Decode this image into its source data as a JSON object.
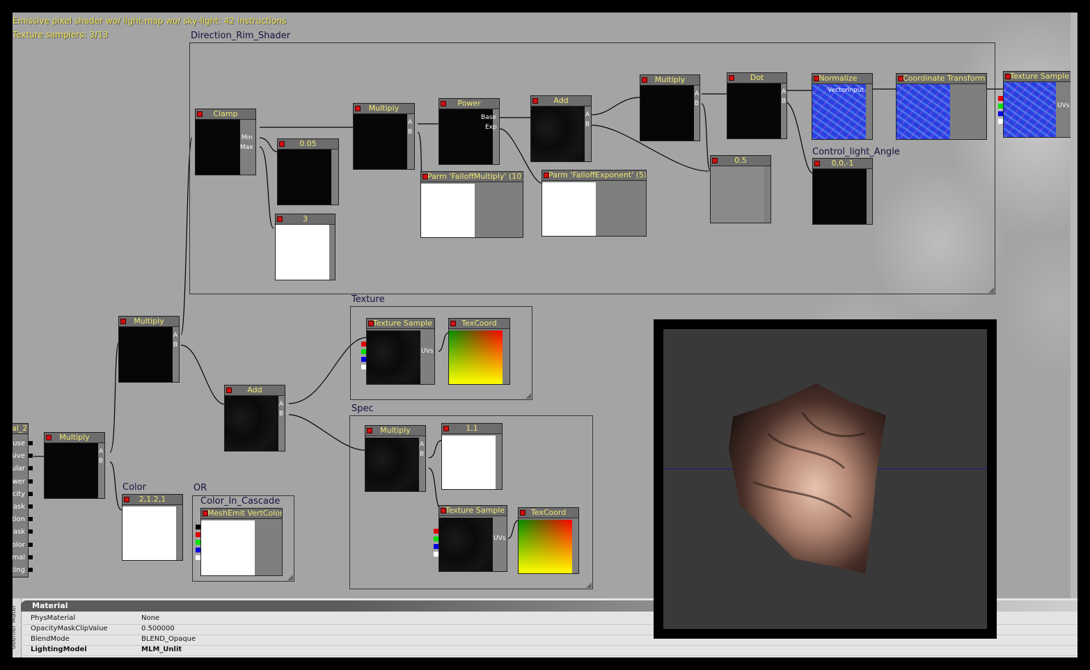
{
  "stats": {
    "line1": "Emissive pixel shader wo/ light-map wo/ sky-light: 42 instructions",
    "line2": "Texture samplers: 3/13"
  },
  "groups": {
    "direction_rim": "Direction_Rim_Shader",
    "texture": "Texture",
    "spec": "Spec",
    "color": "Color",
    "or": "OR",
    "color_in_cascade": "Color_In_Cascade",
    "control_light_angle": "Control_light_Angle"
  },
  "nodes": {
    "clamp": "Clamp",
    "const_005": "0.05",
    "const_3": "3",
    "multiply_top": "Multiply",
    "power": "Power",
    "parm_falloff_multiply": "Parm 'FalloffMultiply' (10)",
    "add_top": "Add",
    "parm_falloff_exponent": "Parm 'FalloffExponent' (5)",
    "multiply_top2": "Multiply",
    "dot": "Dot",
    "const_05": "0.5",
    "normalize": "Normalize",
    "coordinate_transform": "Coordinate Transform",
    "texture_sample_top": "Texture Sample",
    "const_vec": "0,0,-1",
    "multiply_mid": "Multiply",
    "add_mid": "Add",
    "texture_sample_tex": "Texture Sample",
    "texcoord_tex": "TexCoord",
    "multiply_spec": "Multiply",
    "const_11": "1.1",
    "texture_sample_spec": "Texture Sample",
    "texcoord_spec": "TexCoord",
    "multiply_left": "Multiply",
    "color_const": "2,1.2,1",
    "mesh_emit_vertcolor": "MeshEmit VertColor",
    "material_fragment": "al_2"
  },
  "pin_labels": {
    "min": "Min",
    "max": "Max",
    "a": "A",
    "b": "B",
    "base": "Base",
    "exp": "Exp",
    "uvs": "UVs",
    "vector_input": "VectorInput"
  },
  "material_inputs": [
    "fuse",
    "ssive",
    "cular",
    "ower",
    "acity",
    "Mask",
    "rtion",
    "Mask",
    "Color",
    "rmal",
    "hting"
  ],
  "properties": {
    "tab_label": "deemer Mater",
    "header": "Material",
    "rows": [
      {
        "key": "PhysMaterial",
        "value": "None"
      },
      {
        "key": "OpacityMaskClipValue",
        "value": "0.500000"
      },
      {
        "key": "BlendMode",
        "value": "BLEND_Opaque"
      },
      {
        "key": "LightingModel",
        "value": "MLM_Unlit"
      }
    ]
  },
  "colors": {
    "canvas": "#a4a4a4",
    "node_title_text": "#f0e873",
    "group_title_text": "#12123e",
    "stats_text": "#e8e04a",
    "wire": "#000000"
  }
}
